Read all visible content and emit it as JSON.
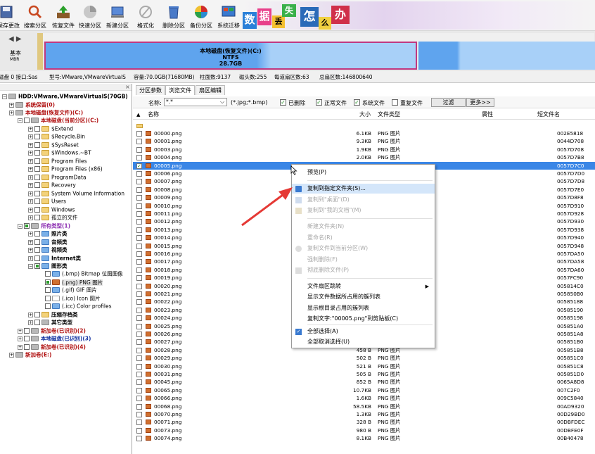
{
  "toolbar": {
    "items": [
      {
        "label": "保存更改",
        "icon": "save-icon"
      },
      {
        "label": "搜索分区",
        "icon": "search-icon"
      },
      {
        "label": "恢复文件",
        "icon": "recover-file-icon"
      },
      {
        "label": "快速分区",
        "icon": "quick-partition-icon"
      },
      {
        "label": "新建分区",
        "icon": "new-partition-icon"
      },
      {
        "label": "格式化",
        "icon": "format-icon"
      },
      {
        "label": "删除分区",
        "icon": "delete-partition-icon"
      },
      {
        "label": "备份分区",
        "icon": "backup-partition-icon"
      },
      {
        "label": "系统迁移",
        "icon": "system-migrate-icon"
      }
    ],
    "promo_chars": [
      "数",
      "据",
      "丢",
      "失",
      "怎",
      "么",
      "办"
    ]
  },
  "disk_map": {
    "basic_label_1": "基本",
    "basic_label_2": "MBR",
    "partition_name": "本地磁盘(恢复文件)(C:)",
    "partition_fs": "NTFS",
    "partition_size": "28.7GB"
  },
  "disk_info": {
    "disk": "磁盘 0 接口:Sas",
    "model": "型号:VMware,VMwareVirtualS",
    "capacity": "容量:70.0GB(71680MB)",
    "cylinders": "柱面数:9137",
    "heads": "磁头数:255",
    "sectors_per_track": "每道扇区数:63",
    "total_sectors": "总扇区数:146800640"
  },
  "tree": {
    "root": "HDD:VMware,VMwareVirtualS(70GB)",
    "nodes": [
      "系统保留(0)",
      "本地磁盘(恢复文件)(C:)",
      "本地磁盘(当前分区)(C:)",
      "$Extend",
      "$Recycle.Bin",
      "$SysReset",
      "$Windows.~BT",
      "Program Files",
      "Program Files (x86)",
      "ProgramData",
      "Recovery",
      "System Volume Information",
      "Users",
      "Windows",
      "孤立的文件",
      "所有类型(1)",
      "照片类",
      "音频类",
      "视频类",
      "Internet类",
      "图形类",
      "(.bmp) Bitmap 位图图像",
      "(.png) PNG 图片",
      "(.gif) GIF 图片",
      "(.ico) Icon 图片",
      "(.icc) Color profiles",
      "压缩存档类",
      "其它类型",
      "新加卷(已识别)(2)",
      "本地磁盘(已识别)(3)",
      "新加卷(已识别)(4)",
      "新加卷(E:)"
    ]
  },
  "tabs": [
    "分区参数",
    "浏览文件",
    "扇区编辑"
  ],
  "filter": {
    "name_label": "名称:",
    "name_value": "*.*",
    "ext_hint": "(*.jpg;*.bmp)",
    "deleted": "已删除",
    "normal": "正常文件",
    "system": "系统文件",
    "duplicate": "重复文件",
    "filter_btn": "过滤",
    "more_btn": "更多>>"
  },
  "columns": {
    "name": "名称",
    "size": "大小",
    "type": "文件类型",
    "attr": "属性",
    "short": "短文件名"
  },
  "files": [
    {
      "name": "00000.png",
      "size": "6.1KB",
      "type": "PNG 图片",
      "short": "002E5818"
    },
    {
      "name": "00001.png",
      "size": "9.3KB",
      "type": "PNG 图片",
      "short": "0044D708"
    },
    {
      "name": "00003.png",
      "size": "1.9KB",
      "type": "PNG 图片",
      "short": "0057D708"
    },
    {
      "name": "00004.png",
      "size": "2.0KB",
      "type": "PNG 图片",
      "short": "0057D7B8"
    },
    {
      "name": "00005.png",
      "size": "",
      "type": "",
      "short": "0057D7C0"
    },
    {
      "name": "00006.png",
      "size": "",
      "type": "",
      "short": "0057D7D0"
    },
    {
      "name": "00007.png",
      "size": "",
      "type": "",
      "short": "0057D7D8"
    },
    {
      "name": "00008.png",
      "size": "",
      "type": "",
      "short": "0057D7E0"
    },
    {
      "name": "00009.png",
      "size": "",
      "type": "",
      "short": "0057D8F8"
    },
    {
      "name": "00010.png",
      "size": "",
      "type": "",
      "short": "0057D910"
    },
    {
      "name": "00011.png",
      "size": "",
      "type": "",
      "short": "0057D928"
    },
    {
      "name": "00012.png",
      "size": "",
      "type": "",
      "short": "0057D930"
    },
    {
      "name": "00013.png",
      "size": "",
      "type": "",
      "short": "0057D938"
    },
    {
      "name": "00014.png",
      "size": "",
      "type": "",
      "short": "0057D940"
    },
    {
      "name": "00015.png",
      "size": "",
      "type": "",
      "short": "0057D948"
    },
    {
      "name": "00016.png",
      "size": "",
      "type": "",
      "short": "0057DA50"
    },
    {
      "name": "00017.png",
      "size": "",
      "type": "",
      "short": "0057DA58"
    },
    {
      "name": "00018.png",
      "size": "",
      "type": "",
      "short": "0057DA60"
    },
    {
      "name": "00019.png",
      "size": "",
      "type": "",
      "short": "0057FC90"
    },
    {
      "name": "00020.png",
      "size": "",
      "type": "",
      "short": "005814C0"
    },
    {
      "name": "00021.png",
      "size": "",
      "type": "",
      "short": "005850B0"
    },
    {
      "name": "00022.png",
      "size": "",
      "type": "",
      "short": "00585188"
    },
    {
      "name": "00023.png",
      "size": "",
      "type": "",
      "short": "00585190"
    },
    {
      "name": "00024.png",
      "size": "",
      "type": "",
      "short": "00585198"
    },
    {
      "name": "00025.png",
      "size": "",
      "type": "",
      "short": "005851A0"
    },
    {
      "name": "00026.png",
      "size": "",
      "type": "",
      "short": "005851A8"
    },
    {
      "name": "00027.png",
      "size": "",
      "type": "",
      "short": "005851B0"
    },
    {
      "name": "00028.png",
      "size": "458 B",
      "type": "PNG 图片",
      "short": "005851B8"
    },
    {
      "name": "00029.png",
      "size": "502 B",
      "type": "PNG 图片",
      "short": "005851C0"
    },
    {
      "name": "00030.png",
      "size": "521 B",
      "type": "PNG 图片",
      "short": "005851C8"
    },
    {
      "name": "00031.png",
      "size": "505 B",
      "type": "PNG 图片",
      "short": "005851D0"
    },
    {
      "name": "00045.png",
      "size": "852 B",
      "type": "PNG 图片",
      "short": "0065A8D8"
    },
    {
      "name": "00065.png",
      "size": "10.7KB",
      "type": "PNG 图片",
      "short": "007C2F0"
    },
    {
      "name": "00066.png",
      "size": "1.6KB",
      "type": "PNG 图片",
      "short": "009C5840"
    },
    {
      "name": "00068.png",
      "size": "58.5KB",
      "type": "PNG 图片",
      "short": "00AD9320"
    },
    {
      "name": "00070.png",
      "size": "1.3KB",
      "type": "PNG 图片",
      "short": "00D29BD0"
    },
    {
      "name": "00071.png",
      "size": "328 B",
      "type": "PNG 图片",
      "short": "00DBFDEC"
    },
    {
      "name": "00073.png",
      "size": "980 B",
      "type": "PNG 图片",
      "short": "00DBFE0F"
    },
    {
      "name": "00074.png",
      "size": "8.1KB",
      "type": "PNG 图片",
      "short": "00B40478"
    }
  ],
  "context_menu": [
    {
      "label": "预览(P)",
      "state": "normal"
    },
    {
      "label": "复制到指定文件夹(S)...",
      "state": "highlight"
    },
    {
      "label": "复制到\"桌面\"(D)",
      "state": "disabled"
    },
    {
      "label": "复制到\"我的文档\"(M)",
      "state": "disabled"
    },
    {
      "label": "新建文件夹(N)",
      "state": "disabled"
    },
    {
      "label": "重命名(R)",
      "state": "disabled"
    },
    {
      "label": "复制文件到当前分区(W)",
      "state": "disabled"
    },
    {
      "label": "强制删除(F)",
      "state": "disabled"
    },
    {
      "label": "彻底删除文件(P)",
      "state": "disabled"
    },
    {
      "label": "文件扇区跳转",
      "state": "normal"
    },
    {
      "label": "显示文件数据所占用的簇列表",
      "state": "normal"
    },
    {
      "label": "显示根目录占用的簇列表",
      "state": "normal"
    },
    {
      "label": "复制文字:\"00005.png\"到剪贴板(C)",
      "state": "normal"
    },
    {
      "label": "全部选择(A)",
      "state": "normal"
    },
    {
      "label": "全部取消选择(U)",
      "state": "normal"
    }
  ],
  "colors": {
    "accent": "#3a86e6",
    "partition_border": "#c03880",
    "arrow": "#e53935"
  }
}
